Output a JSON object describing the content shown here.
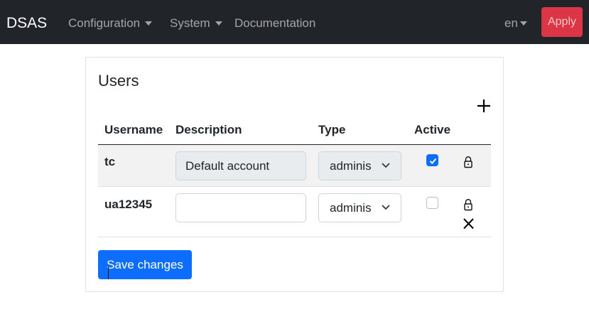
{
  "navbar": {
    "brand": "DSAS",
    "menu": [
      {
        "label": "Configuration",
        "has_dropdown": true
      },
      {
        "label": "System",
        "has_dropdown": true
      },
      {
        "label": "Documentation",
        "has_dropdown": false
      }
    ],
    "language": "en",
    "apply_label": "Apply"
  },
  "users_card": {
    "title": "Users",
    "add_icon": "plus-icon",
    "columns": {
      "username": "Username",
      "description": "Description",
      "type": "Type",
      "active": "Active"
    },
    "rows": [
      {
        "username": "tc",
        "description": "Default account",
        "description_placeholder": "",
        "description_editable": false,
        "type": "adminis",
        "active": true,
        "actions": [
          "lock-icon"
        ]
      },
      {
        "username": "ua12345",
        "description": "",
        "description_placeholder": "",
        "description_editable": true,
        "type": "adminis",
        "active": false,
        "actions": [
          "lock-icon",
          "delete-x-icon"
        ]
      }
    ],
    "save_label": "Save changes"
  },
  "colors": {
    "navbar_bg": "#212529",
    "apply_bg": "#dc3545",
    "primary": "#0d6efd",
    "row_stripe": "#f2f2f2",
    "disabled_input_bg": "#e9ecef"
  }
}
